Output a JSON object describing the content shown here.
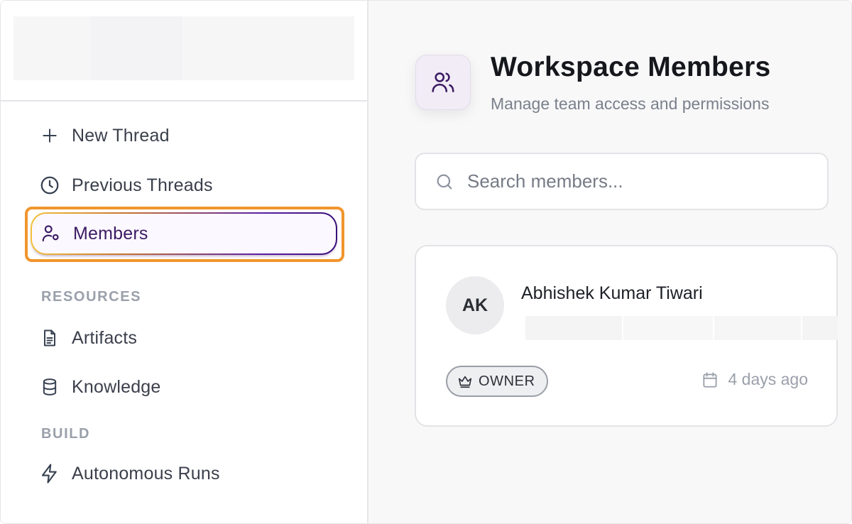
{
  "sidebar": {
    "nav": [
      {
        "label": "New Thread",
        "icon": "plus-icon"
      },
      {
        "label": "Previous Threads",
        "icon": "clock-icon"
      },
      {
        "label": "Members",
        "icon": "user-settings-icon",
        "active": true
      }
    ],
    "resources_label": "RESOURCES",
    "resources": [
      {
        "label": "Artifacts",
        "icon": "document-icon"
      },
      {
        "label": "Knowledge",
        "icon": "database-icon"
      }
    ],
    "build_label": "BUILD",
    "build": [
      {
        "label": "Autonomous Runs",
        "icon": "lightning-icon"
      }
    ]
  },
  "main": {
    "title": "Workspace Members",
    "subtitle": "Manage team access and permissions",
    "search": {
      "placeholder": "Search members..."
    },
    "members": [
      {
        "initials": "AK",
        "name": "Abhishek Kumar Tiwari",
        "role": "OWNER",
        "joined": "4 days ago"
      }
    ]
  },
  "colors": {
    "accent": "#3b1a63",
    "focus_ring": "#f0952d",
    "gradient_start": "#f2c23c",
    "gradient_end": "#3a1078"
  }
}
